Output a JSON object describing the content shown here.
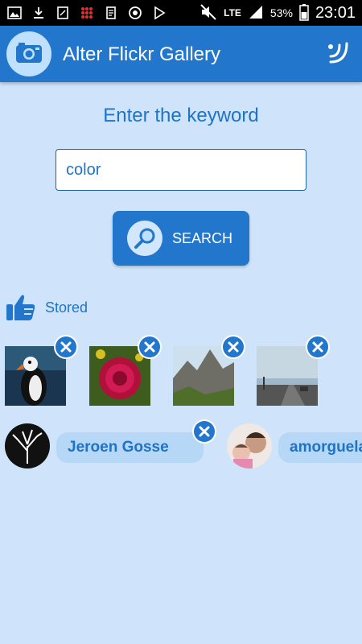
{
  "status_bar": {
    "network": "LTE",
    "battery": "53%",
    "time": "23:01",
    "icons": [
      "image-icon",
      "download-icon",
      "tablet-icon",
      "grid-icon",
      "document-icon",
      "circle-sync-icon",
      "play-store-icon",
      "mute-icon",
      "signal-icon",
      "battery-icon"
    ]
  },
  "app": {
    "title": "Alter Flickr Gallery",
    "logo_icon": "camera-icon",
    "action_icon": "wave-icon",
    "accent": "#2277cc"
  },
  "search": {
    "prompt": "Enter the keyword",
    "value": "color",
    "button_label": "SEARCH",
    "button_icon": "magnifier-icon"
  },
  "stored": {
    "label": "Stored",
    "icon": "thumbs-up-icon",
    "photos": [
      {
        "subject": "puffin-photo"
      },
      {
        "subject": "red-flower-photo"
      },
      {
        "subject": "mountain-photo"
      },
      {
        "subject": "road-sky-photo"
      }
    ],
    "users": [
      {
        "name": "Jeroen Gosse"
      },
      {
        "name": "amorguela"
      }
    ]
  }
}
